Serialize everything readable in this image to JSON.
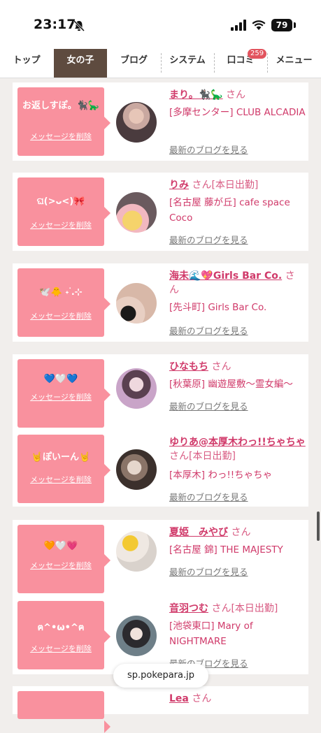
{
  "status": {
    "time": "23:17",
    "battery": "79"
  },
  "nav": {
    "items": [
      {
        "label": "トップ"
      },
      {
        "label": "女の子"
      },
      {
        "label": "ブログ"
      },
      {
        "label": "システム"
      },
      {
        "label": "口コミ",
        "badge": "259"
      },
      {
        "label": "メニュー"
      }
    ]
  },
  "delete_label": "メッセージを削除",
  "blog_label": "最新のブログを見る",
  "cards": [
    {
      "message": "お返しすぽ。🐈‍⬛🦕",
      "name": "まり。🐈‍⬛🦕",
      "suffix": "さん",
      "shop": "[多摩センター] CLUB ALCADIA"
    },
    {
      "message": "ଘ(>ᴗ<)🎀",
      "name": "りみ",
      "suffix": "さん[本日出勤]",
      "shop": "[名古屋 藤が丘] cafe space Coco"
    },
    {
      "message": "🕊️🐥 ˖ ࣪.⊹",
      "name": "海未🌊💖Girls Bar Co.",
      "suffix": "さん",
      "shop": "[先斗町] Girls Bar Co."
    },
    {
      "message": "💙🤍💙",
      "name": "ひなもち",
      "suffix": "さん",
      "shop": "[秋葉原] 幽遊屋敷〜霊女編〜"
    },
    {
      "message": "🤘ぽいーん🤘",
      "name": "ゆりあ@本厚木わっ!!ちゃちゃ",
      "suffix": "さん[本日出勤]",
      "shop": "[本厚木] わっ!!ちゃちゃ"
    },
    {
      "message": "🧡🤍💗",
      "name": "夏姫　みやび",
      "suffix": "さん",
      "shop": "[名古屋 錦] THE MAJESTY"
    },
    {
      "message": "ฅ^•ω•^ฅ",
      "name": "音羽つむ",
      "suffix": "さん[本日出勤]",
      "shop": "[池袋東口] Mary of NIGHTMARE"
    },
    {
      "message": "",
      "name": "Lea",
      "suffix": "さん",
      "shop": ""
    }
  ],
  "browser": {
    "url": "sp.pokepara.jp"
  }
}
